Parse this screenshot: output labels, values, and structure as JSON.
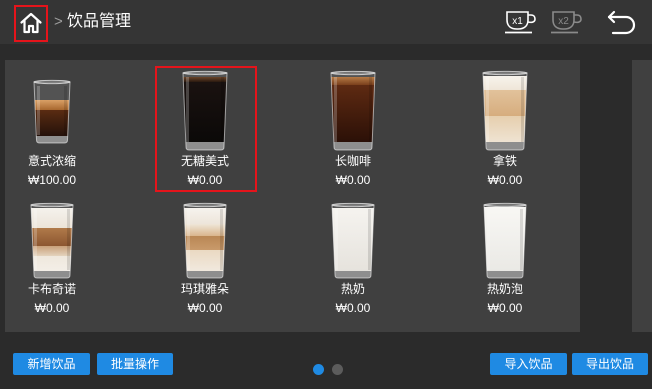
{
  "header": {
    "breadcrumb_separator": ">",
    "title": "饮品管理",
    "cup_x1_label": "x1",
    "cup_x2_label": "x2",
    "home_highlighted": true
  },
  "icons": {
    "home": "home-icon",
    "cup_x1": "cup-x1-icon",
    "cup_x2": "cup-x2-icon",
    "back": "back-arrow-icon"
  },
  "drinks": [
    {
      "name": "意式浓缩",
      "price": "₩100.00",
      "image": "espresso-glass",
      "highlighted": false
    },
    {
      "name": "无糖美式",
      "price": "₩0.00",
      "image": "americano-glass",
      "highlighted": true
    },
    {
      "name": "长咖啡",
      "price": "₩0.00",
      "image": "long-coffee-glass",
      "highlighted": false
    },
    {
      "name": "拿铁",
      "price": "₩0.00",
      "image": "latte-glass",
      "highlighted": false
    },
    {
      "name": "卡布奇诺",
      "price": "₩0.00",
      "image": "cappuccino-glass",
      "highlighted": false
    },
    {
      "name": "玛琪雅朵",
      "price": "₩0.00",
      "image": "macchiato-glass",
      "highlighted": false
    },
    {
      "name": "热奶",
      "price": "₩0.00",
      "image": "hot-milk-glass",
      "highlighted": false
    },
    {
      "name": "热奶泡",
      "price": "₩0.00",
      "image": "milk-foam-glass",
      "highlighted": false
    }
  ],
  "actions": {
    "add_drink": "新增饮品",
    "batch_operation": "批量操作",
    "import_drinks": "导入饮品",
    "export_drinks": "导出饮品"
  },
  "pagination": {
    "pages": 2,
    "current": 1
  },
  "colors": {
    "accent": "#1f8ae3",
    "highlight": "#e5141b",
    "inactive_dot": "#5c5c5c",
    "disabled_icon": "#8a8a8a"
  }
}
